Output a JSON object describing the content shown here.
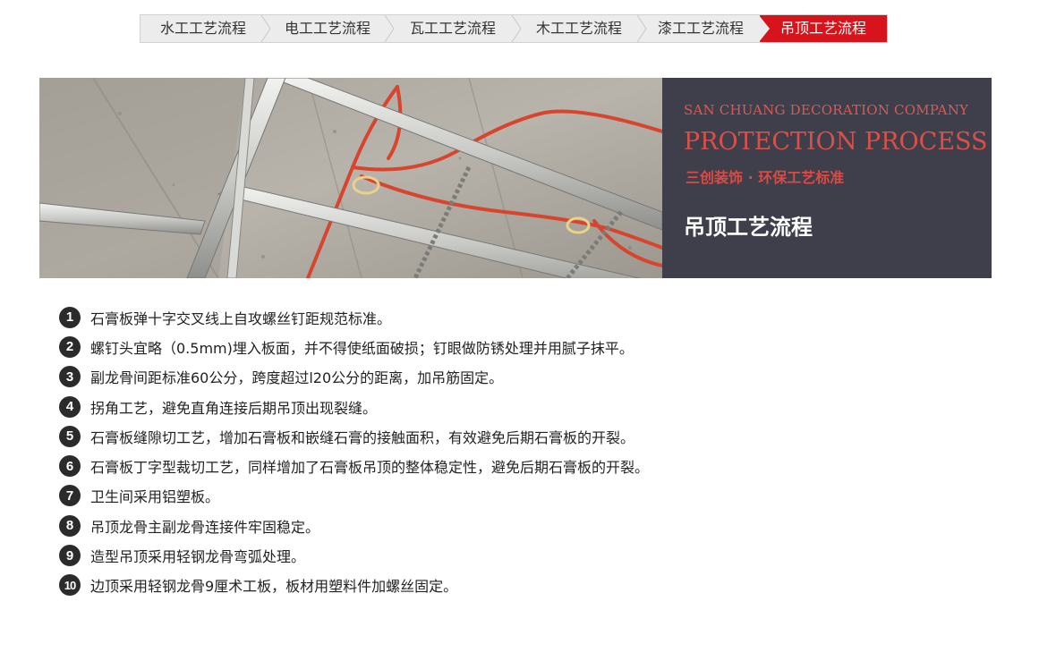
{
  "tabs": [
    {
      "label": "水工工艺流程",
      "active": false
    },
    {
      "label": "电工工艺流程",
      "active": false
    },
    {
      "label": "瓦工工艺流程",
      "active": false
    },
    {
      "label": "木工工艺流程",
      "active": false
    },
    {
      "label": "漆工工艺流程",
      "active": false
    },
    {
      "label": "吊顶工艺流程",
      "active": true
    }
  ],
  "banner": {
    "company": "SAN CHUANG DECORATION COMPANY",
    "process": "PROTECTION PROCESS",
    "subtitle": "三创装饰 · 环保工艺标准",
    "title": "吊顶工艺流程"
  },
  "steps": [
    {
      "num": "1",
      "text": "石膏板弹十字交叉线上自攻螺丝钉距规范标准。"
    },
    {
      "num": "2",
      "text": "螺钉头宜略（0.5mm)埋入板面，并不得使纸面破损；钉眼做防锈处理并用腻子抹平。"
    },
    {
      "num": "3",
      "text": "副龙骨间距标准60公分，跨度超过l20公分的距离，加吊筋固定。"
    },
    {
      "num": "4",
      "text": "拐角工艺，避免直角连接后期吊顶出现裂缝。"
    },
    {
      "num": "5",
      "text": "石膏板缝隙切工艺，增加石膏板和嵌缝石膏的接触面积，有效避免后期石膏板的开裂。"
    },
    {
      "num": "6",
      "text": "石膏板丁字型裁切工艺，同样增加了石膏板吊顶的整体稳定性，避免后期石膏板的开裂。"
    },
    {
      "num": "7",
      "text": "卫生间采用铝塑板。"
    },
    {
      "num": "8",
      "text": "吊顶龙骨主副龙骨连接件牢固稳定。"
    },
    {
      "num": "9",
      "text": "造型吊顶采用轻钢龙骨弯弧处理。"
    },
    {
      "num": "10",
      "text": "边顶采用轻钢龙骨9厘术工板，板材用塑料件加螺丝固定。"
    }
  ],
  "colors": {
    "accent": "#d7141c",
    "panel": "#3e3f4a",
    "banner_text": "#d9504a"
  }
}
